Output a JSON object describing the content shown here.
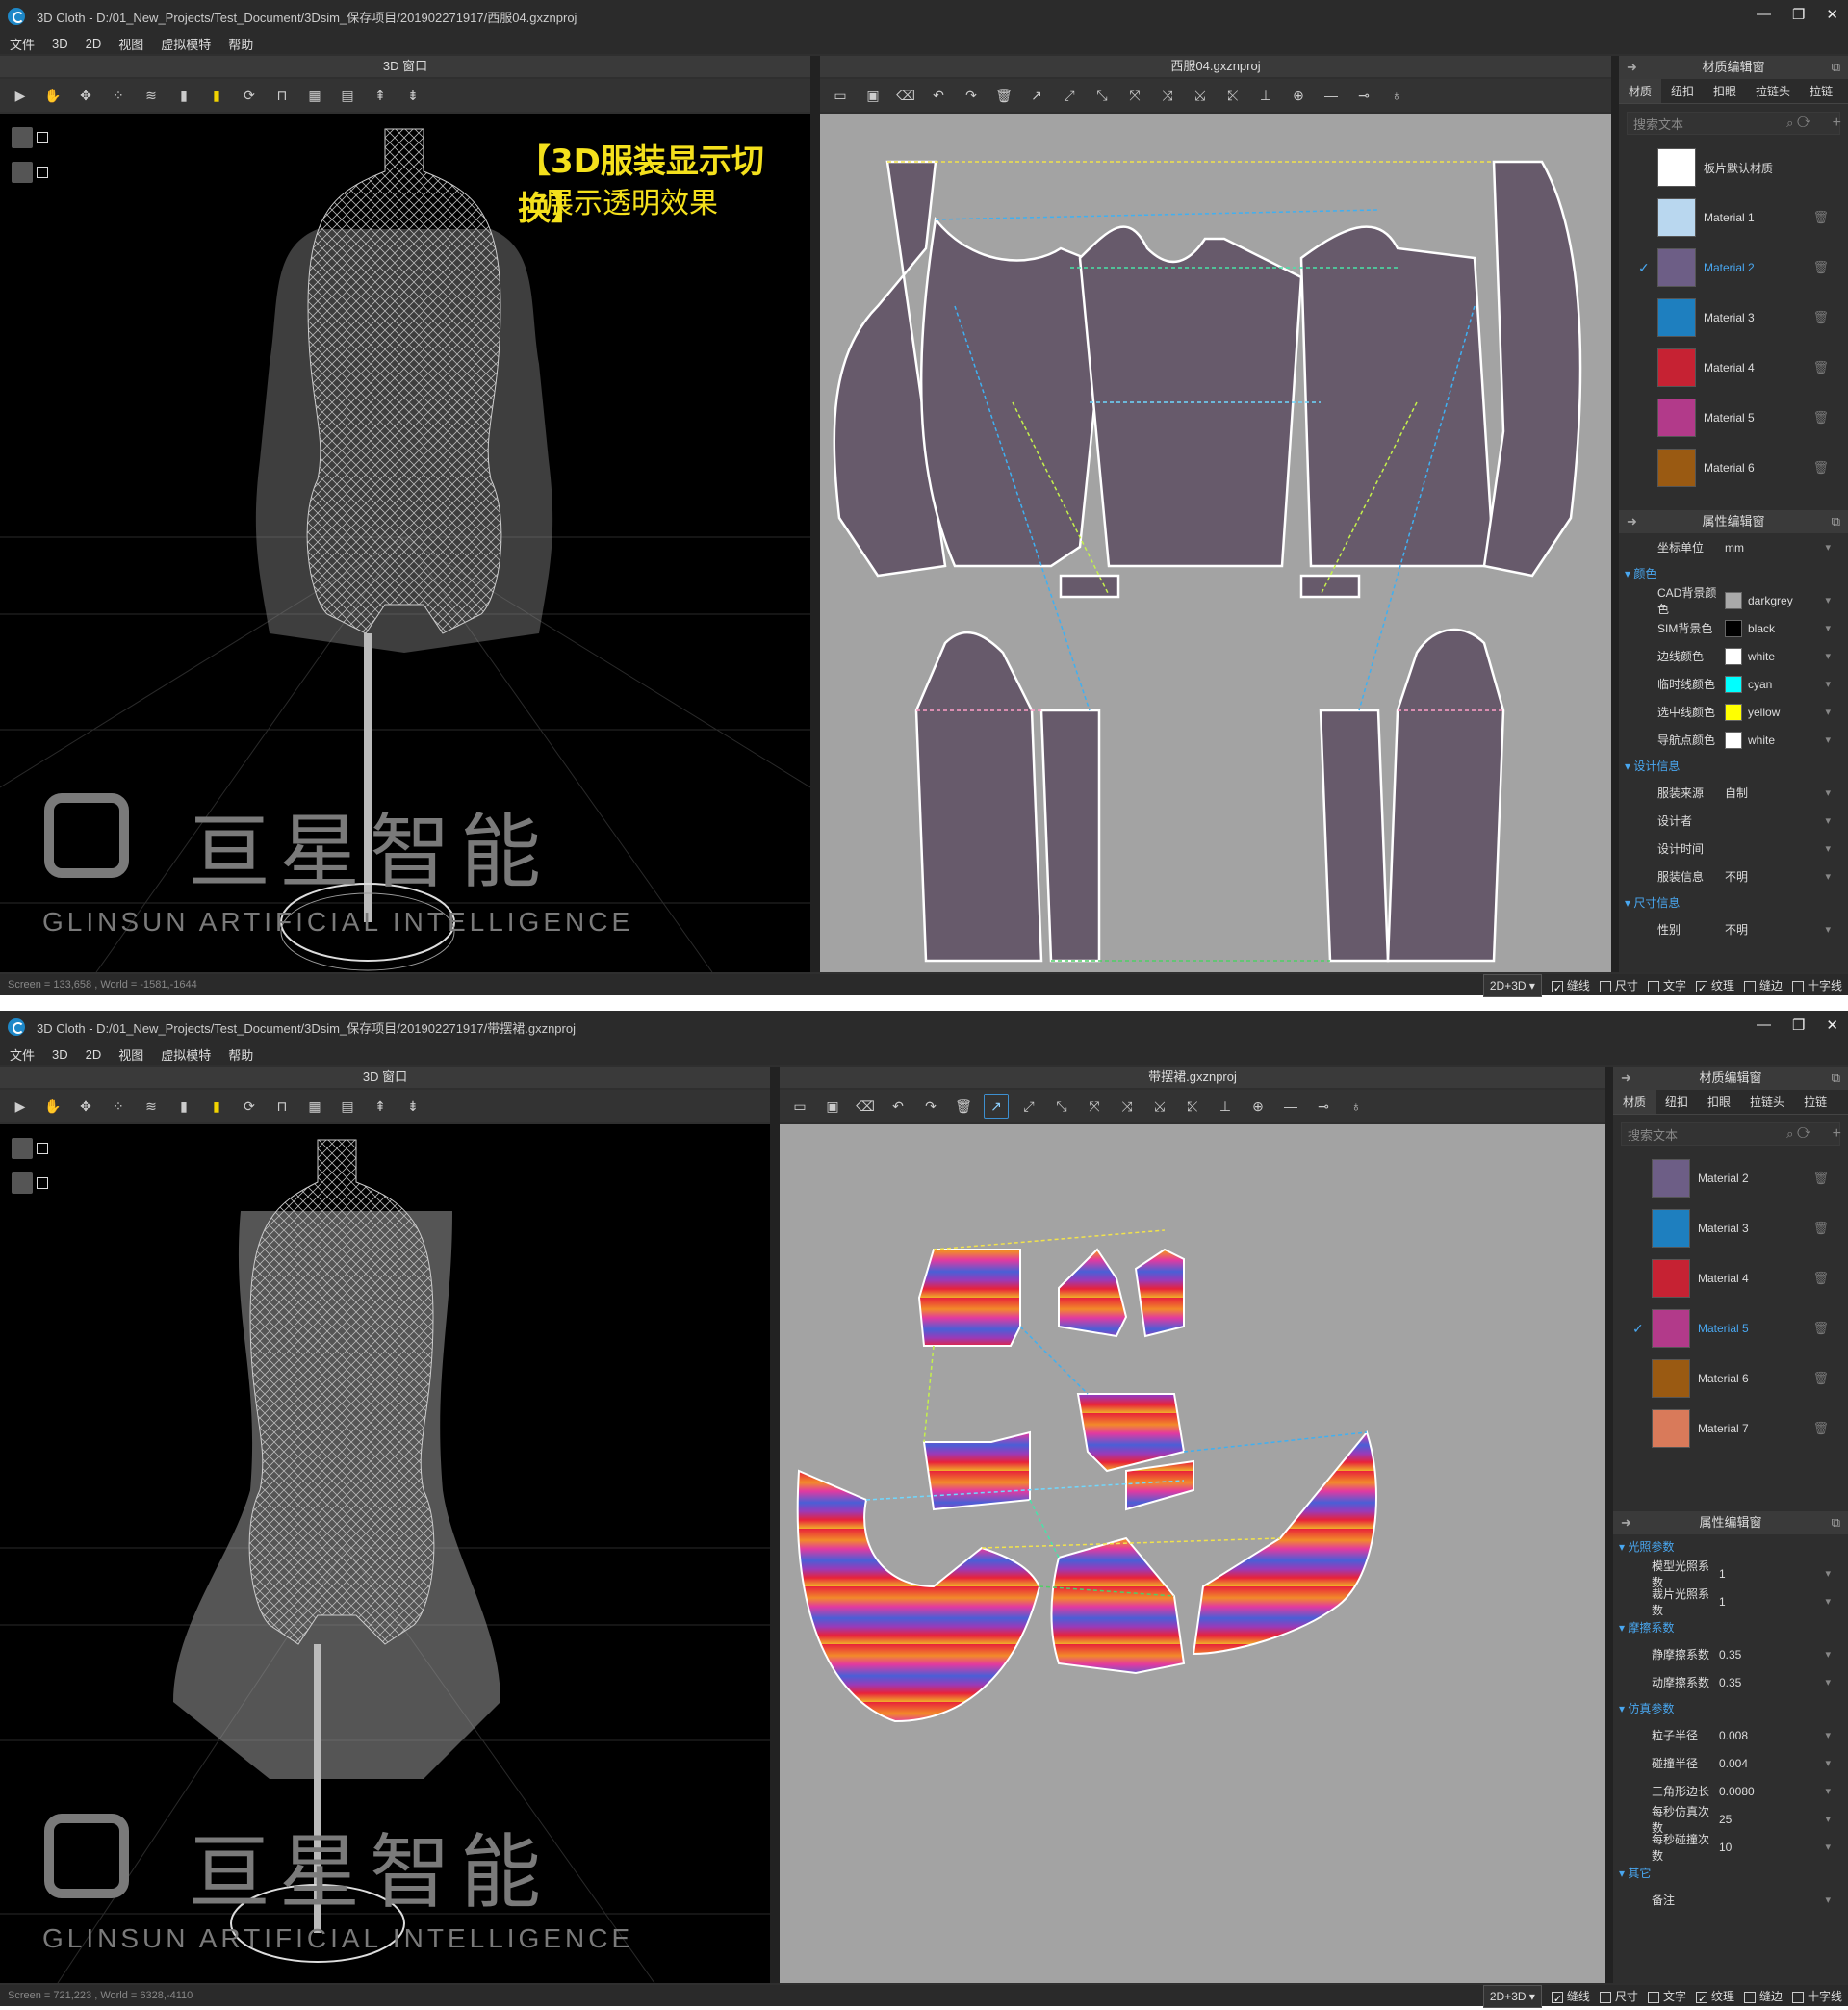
{
  "win1": {
    "title": "3D Cloth - D:/01_New_Projects/Test_Document/3Dsim_保存项目/201902271917/西服04.gxznproj",
    "menu": [
      "文件",
      "3D",
      "2D",
      "视图",
      "虚拟模特",
      "帮助"
    ],
    "panel3d_title": "3D 窗口",
    "panel2d_title": "西服04.gxznproj",
    "annotation_line1": "【3D服装显示切换】",
    "annotation_line2": "展示透明效果",
    "watermark_cn": "亘星智能",
    "watermark_en": "GLINSUN ARTIFICIAL INTELLIGENCE",
    "status_text": "Screen = 133,658 , World = -1581,-1644",
    "sidebar": {
      "title": "材质编辑窗",
      "tabs": [
        "材质",
        "纽扣",
        "扣眼",
        "拉链头",
        "拉链"
      ],
      "search_placeholder": "搜索文本",
      "materials": [
        {
          "name": "板片默认材质",
          "color": "#ffffff",
          "selected": false,
          "deletable": false
        },
        {
          "name": "Material 1",
          "color": "#b9d7ef",
          "selected": false,
          "deletable": true
        },
        {
          "name": "Material 2",
          "color": "#6d5e86",
          "selected": true,
          "deletable": true
        },
        {
          "name": "Material 3",
          "color": "#1e7fbf",
          "selected": false,
          "deletable": true
        },
        {
          "name": "Material 4",
          "color": "#c62233",
          "selected": false,
          "deletable": true
        },
        {
          "name": "Material 5",
          "color": "#b23a8a",
          "selected": false,
          "deletable": true
        },
        {
          "name": "Material 6",
          "color": "#9a5a12",
          "selected": false,
          "deletable": true
        }
      ],
      "props_title": "属性编辑窗",
      "props": [
        {
          "type": "row",
          "k": "坐标单位",
          "v": "mm"
        },
        {
          "type": "group",
          "k": "颜色"
        },
        {
          "type": "row",
          "k": "CAD背景颜色",
          "v": "darkgrey",
          "sw": "#a9a9a9"
        },
        {
          "type": "row",
          "k": "SIM背景色",
          "v": "black",
          "sw": "#000000"
        },
        {
          "type": "row",
          "k": "边线颜色",
          "v": "white",
          "sw": "#ffffff"
        },
        {
          "type": "row",
          "k": "临时线颜色",
          "v": "cyan",
          "sw": "#00ffff"
        },
        {
          "type": "row",
          "k": "选中线颜色",
          "v": "yellow",
          "sw": "#ffff00"
        },
        {
          "type": "row",
          "k": "导航点颜色",
          "v": "white",
          "sw": "#ffffff"
        },
        {
          "type": "group",
          "k": "设计信息"
        },
        {
          "type": "row",
          "k": "服装来源",
          "v": "自制"
        },
        {
          "type": "row",
          "k": "设计者",
          "v": ""
        },
        {
          "type": "row",
          "k": "设计时间",
          "v": ""
        },
        {
          "type": "row",
          "k": "服装信息",
          "v": "不明"
        },
        {
          "type": "group",
          "k": "尺寸信息"
        },
        {
          "type": "row",
          "k": "性别",
          "v": "不明"
        }
      ]
    },
    "statusbar_right": {
      "mode": "2D+3D",
      "items": [
        {
          "label": "缝线",
          "checked": true
        },
        {
          "label": "尺寸",
          "checked": false
        },
        {
          "label": "文字",
          "checked": false
        },
        {
          "label": "纹理",
          "checked": true
        },
        {
          "label": "缝边",
          "checked": false
        },
        {
          "label": "十字线",
          "checked": false
        }
      ]
    }
  },
  "win2": {
    "title": "3D Cloth - D:/01_New_Projects/Test_Document/3Dsim_保存项目/201902271917/带摆裙.gxznproj",
    "menu": [
      "文件",
      "3D",
      "2D",
      "视图",
      "虚拟模特",
      "帮助"
    ],
    "panel3d_title": "3D 窗口",
    "panel2d_title": "带摆裙.gxznproj",
    "watermark_cn": "亘星智能",
    "watermark_en": "GLINSUN ARTIFICIAL INTELLIGENCE",
    "status_text": "Screen = 721,223 , World = 6328,-4110",
    "sidebar": {
      "title": "材质编辑窗",
      "tabs": [
        "材质",
        "纽扣",
        "扣眼",
        "拉链头",
        "拉链"
      ],
      "search_placeholder": "搜索文本",
      "materials": [
        {
          "name": "Material 2",
          "color": "#6d5e86",
          "selected": false,
          "deletable": true
        },
        {
          "name": "Material 3",
          "color": "#1e7fbf",
          "selected": false,
          "deletable": true
        },
        {
          "name": "Material 4",
          "color": "#c62233",
          "selected": false,
          "deletable": true
        },
        {
          "name": "Material 5",
          "color": "#b23a8a",
          "selected": true,
          "deletable": true
        },
        {
          "name": "Material 6",
          "color": "#9a5a12",
          "selected": false,
          "deletable": true
        },
        {
          "name": "Material 7",
          "color": "#d97a5a",
          "selected": false,
          "deletable": true
        }
      ],
      "props_title": "属性编辑窗",
      "props": [
        {
          "type": "group",
          "k": "光照参数"
        },
        {
          "type": "row",
          "k": "模型光照系数",
          "v": "1"
        },
        {
          "type": "row",
          "k": "裁片光照系数",
          "v": "1"
        },
        {
          "type": "group",
          "k": "摩擦系数"
        },
        {
          "type": "row",
          "k": "静摩擦系数",
          "v": "0.35"
        },
        {
          "type": "row",
          "k": "动摩擦系数",
          "v": "0.35"
        },
        {
          "type": "group",
          "k": "仿真参数"
        },
        {
          "type": "row",
          "k": "粒子半径",
          "v": "0.008"
        },
        {
          "type": "row",
          "k": "碰撞半径",
          "v": "0.004"
        },
        {
          "type": "row",
          "k": "三角形边长",
          "v": "0.0080"
        },
        {
          "type": "row",
          "k": "每秒仿真次数",
          "v": "25"
        },
        {
          "type": "row",
          "k": "每秒碰撞次数",
          "v": "10"
        },
        {
          "type": "group",
          "k": "其它"
        },
        {
          "type": "row",
          "k": "备注",
          "v": ""
        }
      ]
    },
    "statusbar_right": {
      "mode": "2D+3D",
      "items": [
        {
          "label": "缝线",
          "checked": true
        },
        {
          "label": "尺寸",
          "checked": false
        },
        {
          "label": "文字",
          "checked": false
        },
        {
          "label": "纹理",
          "checked": true
        },
        {
          "label": "缝边",
          "checked": false
        },
        {
          "label": "十字线",
          "checked": false
        }
      ]
    }
  },
  "icons": {
    "play": "play-icon",
    "hand": "hand-icon",
    "move": "move-icon",
    "points": "points-icon",
    "wind": "wind-icon",
    "garment": "garment-icon",
    "garment_yellow": "garment-yellow-icon",
    "rotate": "rotate-icon",
    "undo": "undo-icon",
    "redo": "redo-icon",
    "open": "open-folder-icon",
    "save": "save-icon"
  },
  "colors": {
    "pattern_fill": "#675a6b",
    "pattern_bg": "#a3a3a3",
    "sim_bg": "#000000",
    "accent": "#49a7f0",
    "annotation": "#f4e01c"
  }
}
